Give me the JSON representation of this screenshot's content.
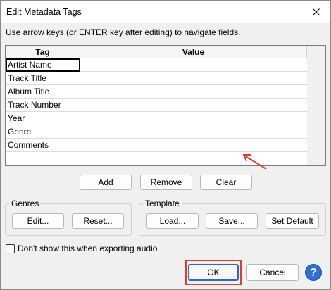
{
  "window": {
    "title": "Edit Metadata Tags",
    "close_glyph": "✕"
  },
  "instructions": "Use arrow keys (or ENTER key after editing) to navigate fields.",
  "table": {
    "columns": [
      "Tag",
      "Value"
    ],
    "rows": [
      {
        "tag": "Artist Name",
        "value": ""
      },
      {
        "tag": "Track Title",
        "value": ""
      },
      {
        "tag": "Album Title",
        "value": ""
      },
      {
        "tag": "Track Number",
        "value": ""
      },
      {
        "tag": "Year",
        "value": ""
      },
      {
        "tag": "Genre",
        "value": ""
      },
      {
        "tag": "Comments",
        "value": ""
      },
      {
        "tag": "",
        "value": ""
      }
    ],
    "selected_row": 0
  },
  "table_buttons": {
    "add": "Add",
    "remove": "Remove",
    "clear": "Clear"
  },
  "genres": {
    "label": "Genres",
    "edit": "Edit...",
    "reset": "Reset..."
  },
  "template": {
    "label": "Template",
    "load": "Load...",
    "save": "Save...",
    "set_default": "Set Default"
  },
  "dont_show": {
    "label": "Don't show this when exporting audio",
    "checked": false
  },
  "footer": {
    "ok": "OK",
    "cancel": "Cancel",
    "help": "?"
  },
  "colors": {
    "annotation_red": "#d9412a",
    "help_blue": "#2f6fd6"
  }
}
